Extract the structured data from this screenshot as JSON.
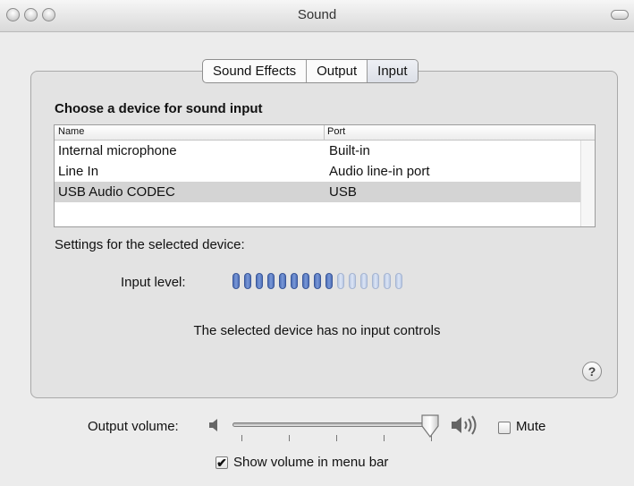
{
  "window": {
    "title": "Sound"
  },
  "tabs": [
    {
      "label": "Sound Effects",
      "selected": false
    },
    {
      "label": "Output",
      "selected": false
    },
    {
      "label": "Input",
      "selected": true
    }
  ],
  "input": {
    "heading": "Choose a device for sound input",
    "columns": [
      "Name",
      "Port"
    ],
    "devices": [
      {
        "name": "Internal microphone",
        "port": "Built-in",
        "selected": false
      },
      {
        "name": "Line In",
        "port": "Audio line-in port",
        "selected": false
      },
      {
        "name": "USB Audio CODEC",
        "port": "USB",
        "selected": true
      }
    ],
    "settings_label": "Settings for the selected device:",
    "level_label": "Input level:",
    "level_total_segments": 15,
    "level_active_segments": 9,
    "no_controls_text": "The selected device has no input controls"
  },
  "help": {
    "glyph": "?"
  },
  "output": {
    "volume_label": "Output volume:",
    "volume_fraction": 0.98,
    "mute_label": "Mute",
    "mute_checked": false,
    "menu_bar_label": "Show volume in menu bar",
    "menu_bar_checked": true
  },
  "icons": {
    "speaker_low": "speaker-low-icon",
    "speaker_high": "speaker-high-icon",
    "checkmark": "✔"
  },
  "colors": {
    "meter_on": "#5b7dc6",
    "meter_off": "#c8d5ee",
    "selection_row": "#d4d4d4"
  }
}
